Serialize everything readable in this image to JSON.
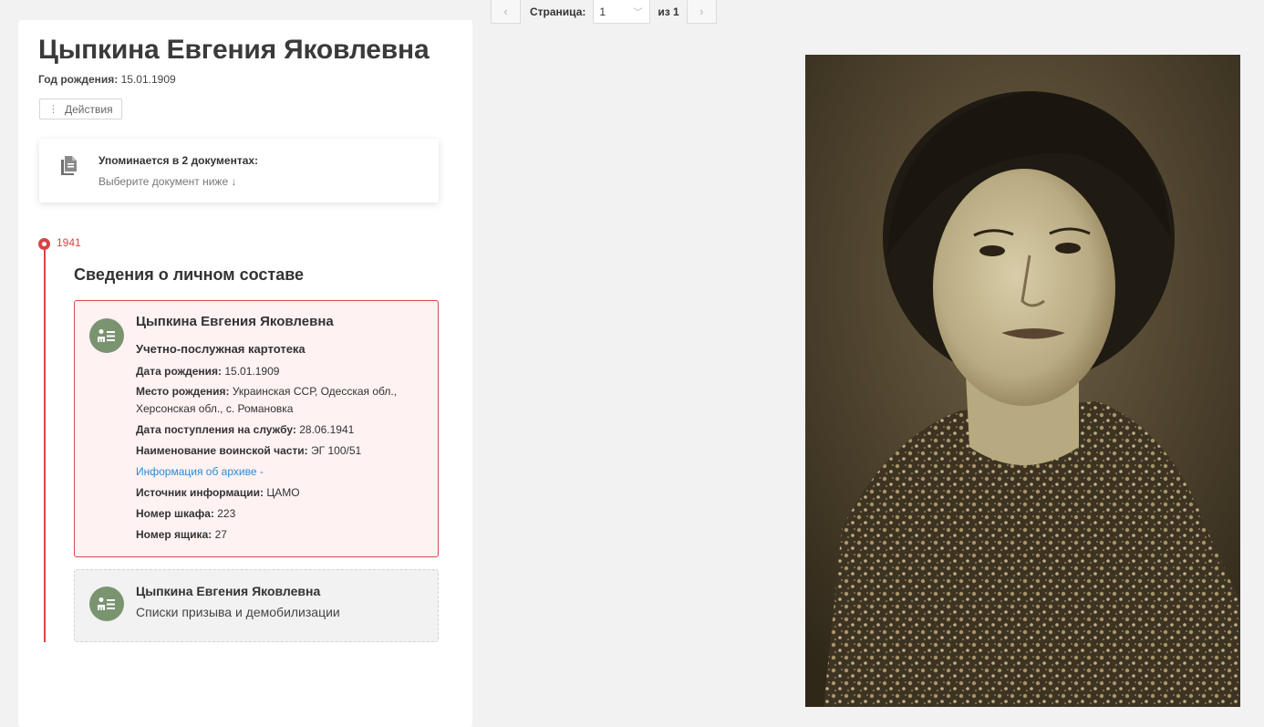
{
  "pager": {
    "label": "Страница:",
    "current": "1",
    "of": "из 1",
    "prev": "‹",
    "next": "›",
    "chevron": "﹀"
  },
  "person": {
    "name": "Цыпкина Евгения Яковлевна",
    "birth_label": "Год рождения:",
    "birth_value": "15.01.1909",
    "actions_dots": "⋮",
    "actions_label": "Действия"
  },
  "mention": {
    "title": "Упоминается в 2 документах:",
    "subtitle": "Выберите документ ниже ↓"
  },
  "timeline": {
    "year": "1941",
    "section_title": "Сведения о личном составе"
  },
  "cards": [
    {
      "name": "Цыпкина Евгения Яковлевна",
      "type": "Учетно-послужная картотека",
      "fields": [
        {
          "label": "Дата рождения:",
          "value": "15.01.1909"
        },
        {
          "label": "Место рождения:",
          "value": "Украинская ССР, Одесская обл., Херсонская обл., с. Романовка"
        },
        {
          "label": "Дата поступления на службу:",
          "value": "28.06.1941"
        },
        {
          "label": "Наименование воинской части:",
          "value": "ЭГ 100/51"
        },
        {
          "link": "Информация об архиве -"
        },
        {
          "label": "Источник информации:",
          "value": "ЦАМО"
        },
        {
          "label": "Номер шкафа:",
          "value": "223"
        },
        {
          "label": "Номер ящика:",
          "value": "27"
        }
      ]
    },
    {
      "name": "Цыпкина Евгения Яковлевна",
      "type": "Списки призыва и демобилизации"
    }
  ],
  "icons": {
    "document": "documents-icon",
    "person_card": "person-card-icon"
  },
  "colors": {
    "accent": "#d64545",
    "link": "#2a8bd6",
    "avatar": "#7a9470",
    "active_card_bg": "#fff2f2"
  }
}
